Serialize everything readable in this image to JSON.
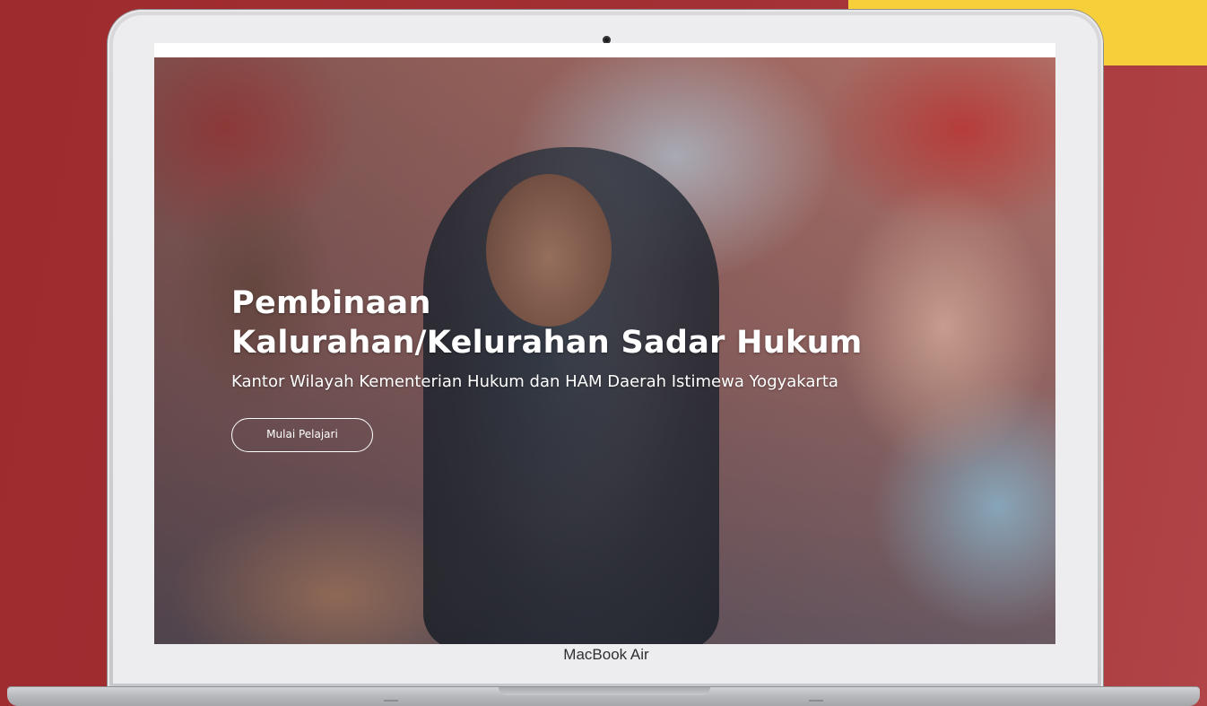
{
  "hero": {
    "title_line1": "Pembinaan",
    "title_line2": "Kalurahan/Kelurahan Sadar Hukum",
    "subtitle": "Kantor Wilayah Kementerian Hukum dan HAM Daerah Istimewa Yogyakarta",
    "cta_label": "Mulai Pelajari"
  },
  "device": {
    "model_label": "MacBook Air"
  },
  "colors": {
    "background": "#a33034",
    "accent": "#f6d03a",
    "hero_text": "#ffffff"
  }
}
